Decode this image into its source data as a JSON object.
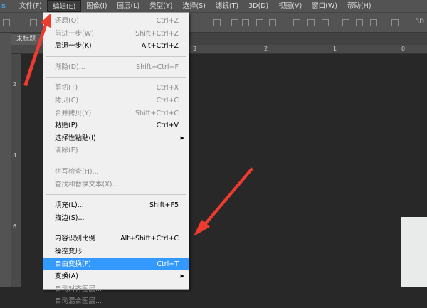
{
  "app_logo": "s",
  "menubar": [
    "文件(F)",
    "编辑(E)",
    "图像(I)",
    "图层(L)",
    "类型(Y)",
    "选择(S)",
    "滤镜(T)",
    "3D(D)",
    "视图(V)",
    "窗口(W)",
    "帮助(H)"
  ],
  "toolbar": {
    "label_3d": "3D"
  },
  "tab": {
    "title": "未标题"
  },
  "ruler_h": [
    "3",
    "2",
    "1",
    "0"
  ],
  "ruler_v": [
    "2",
    "4",
    "6"
  ],
  "edit_menu": {
    "groups": [
      [
        {
          "label": "还原(O)",
          "shortcut": "Ctrl+Z",
          "disabled": true
        },
        {
          "label": "前进一步(W)",
          "shortcut": "Shift+Ctrl+Z",
          "disabled": true
        },
        {
          "label": "后退一步(K)",
          "shortcut": "Alt+Ctrl+Z",
          "disabled": false
        }
      ],
      [
        {
          "label": "渐隐(D)...",
          "shortcut": "Shift+Ctrl+F",
          "disabled": true
        }
      ],
      [
        {
          "label": "剪切(T)",
          "shortcut": "Ctrl+X",
          "disabled": true
        },
        {
          "label": "拷贝(C)",
          "shortcut": "Ctrl+C",
          "disabled": true
        },
        {
          "label": "合并拷贝(Y)",
          "shortcut": "Shift+Ctrl+C",
          "disabled": true
        },
        {
          "label": "粘贴(P)",
          "shortcut": "Ctrl+V",
          "disabled": false
        },
        {
          "label": "选择性粘贴(I)",
          "shortcut": "",
          "disabled": false,
          "submenu": true
        },
        {
          "label": "清除(E)",
          "shortcut": "",
          "disabled": true
        }
      ],
      [
        {
          "label": "拼写检查(H)...",
          "shortcut": "",
          "disabled": true
        },
        {
          "label": "查找和替换文本(X)...",
          "shortcut": "",
          "disabled": true
        }
      ],
      [
        {
          "label": "填充(L)...",
          "shortcut": "Shift+F5",
          "disabled": false
        },
        {
          "label": "描边(S)...",
          "shortcut": "",
          "disabled": false
        }
      ],
      [
        {
          "label": "内容识别比例",
          "shortcut": "Alt+Shift+Ctrl+C",
          "disabled": false
        },
        {
          "label": "操控变形",
          "shortcut": "",
          "disabled": false
        },
        {
          "label": "自由变换(F)",
          "shortcut": "Ctrl+T",
          "disabled": false,
          "highlighted": true
        },
        {
          "label": "变换(A)",
          "shortcut": "",
          "disabled": false,
          "submenu": true
        },
        {
          "label": "自动对齐图层...",
          "shortcut": "",
          "disabled": true
        },
        {
          "label": "自动混合图层...",
          "shortcut": "",
          "disabled": true
        }
      ]
    ]
  },
  "colors": {
    "highlight": "#3399ff",
    "arrow": "#ee3b2f",
    "menubar": "#535353",
    "canvas": "#282828"
  }
}
